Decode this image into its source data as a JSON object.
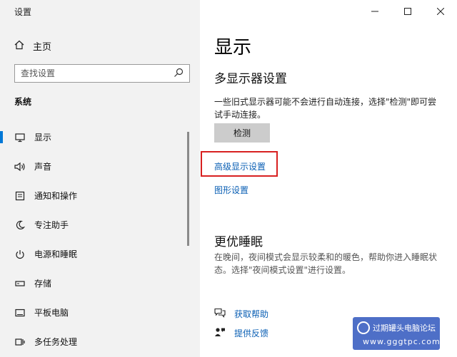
{
  "window": {
    "title": "设置"
  },
  "sidebar": {
    "home_label": "主页",
    "search_placeholder": "查找设置",
    "section_label": "系统",
    "items": [
      {
        "label": "显示",
        "icon": "monitor-icon",
        "active": true
      },
      {
        "label": "声音",
        "icon": "speaker-icon",
        "active": false
      },
      {
        "label": "通知和操作",
        "icon": "notification-icon",
        "active": false
      },
      {
        "label": "专注助手",
        "icon": "moon-icon",
        "active": false
      },
      {
        "label": "电源和睡眠",
        "icon": "power-icon",
        "active": false
      },
      {
        "label": "存储",
        "icon": "storage-icon",
        "active": false
      },
      {
        "label": "平板电脑",
        "icon": "tablet-icon",
        "active": false
      },
      {
        "label": "多任务处理",
        "icon": "multitask-icon",
        "active": false
      }
    ]
  },
  "main": {
    "page_title": "显示",
    "multi_display": {
      "heading": "多显示器设置",
      "description": "一些旧式显示器可能不会进行自动连接，选择\"检测\"即可尝试手动连接。",
      "detect_button": "检测"
    },
    "links": {
      "advanced": "高级显示设置",
      "graphics": "图形设置"
    },
    "sleep": {
      "heading": "更优睡眠",
      "description": "在晚间，夜间模式会显示较柔和的暖色，帮助你进入睡眠状态。选择\"夜间模式设置\"进行设置。"
    },
    "help": {
      "get_help": "获取帮助",
      "feedback": "提供反馈"
    }
  },
  "watermark": {
    "name": "过期罐头电脑论坛",
    "url": "www.gggtpc.com"
  },
  "colors": {
    "accent": "#0078d7",
    "link": "#0a5fb4",
    "highlight": "#d82020",
    "sidebar_bg": "#f2f2f2"
  }
}
